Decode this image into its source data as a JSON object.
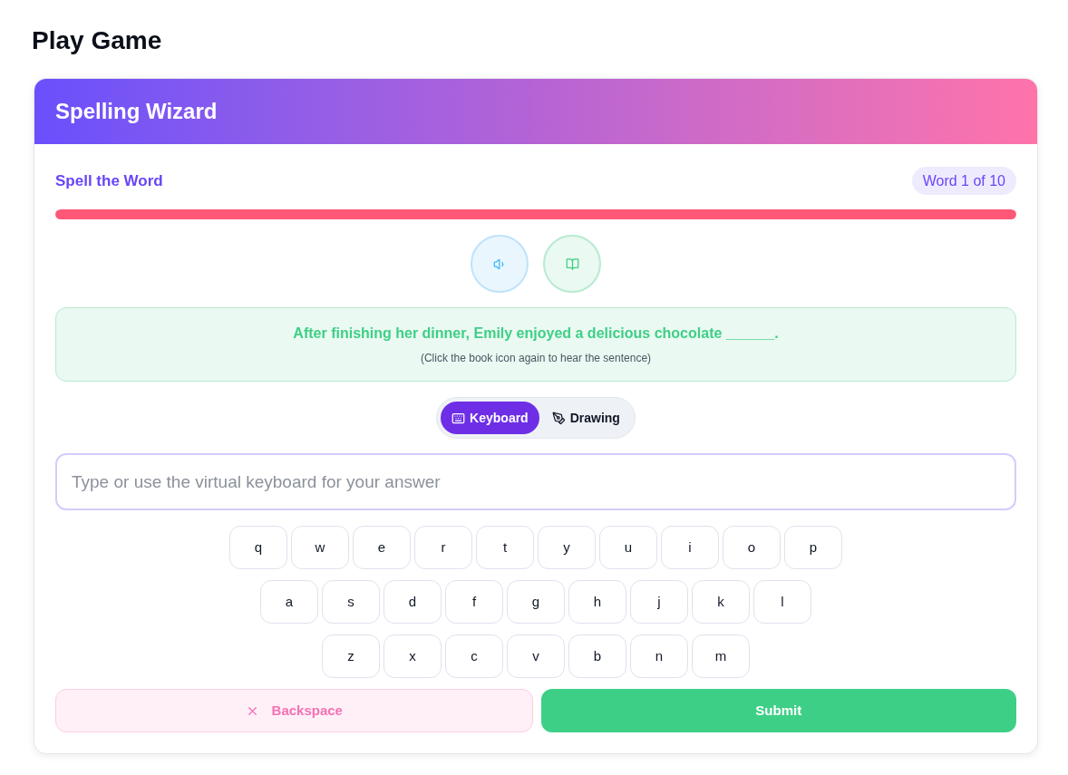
{
  "page": {
    "title": "Play Game"
  },
  "game": {
    "title": "Spelling Wizard",
    "subtitle": "Spell the Word",
    "counter": "Word 1 of 10",
    "progress": {
      "level": 1
    }
  },
  "sentence": {
    "text": "After finishing her dinner, Emily enjoyed a delicious chocolate ______.",
    "hint": "(Click the book icon again to hear the sentence)"
  },
  "modes": [
    {
      "label": "Keyboard",
      "kind": "keyboard",
      "selected": true
    },
    {
      "label": "Drawing",
      "kind": "drawing",
      "selected": false
    }
  ],
  "answer": {
    "placeholder": "Type or use the virtual keyboard for your answer"
  },
  "keyboard": {
    "rows": [
      [
        "q",
        "w",
        "e",
        "r",
        "t",
        "y",
        "u",
        "i",
        "o",
        "p"
      ],
      [
        "a",
        "s",
        "d",
        "f",
        "g",
        "h",
        "j",
        "k",
        "l"
      ],
      [
        "z",
        "x",
        "c",
        "v",
        "b",
        "n",
        "m"
      ]
    ]
  },
  "actions": [
    {
      "label": "Backspace",
      "kind": "backspace"
    },
    {
      "label": "Submit",
      "kind": "submit"
    }
  ]
}
